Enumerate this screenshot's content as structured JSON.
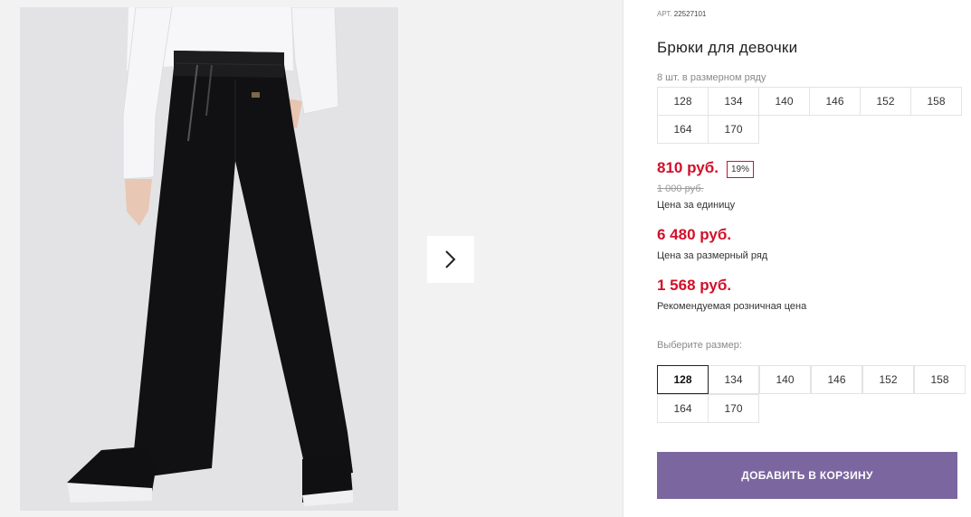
{
  "product": {
    "art_label": "АРТ.",
    "art_value": "22527101",
    "title": "Брюки для девочки",
    "pack_note": "8 шт. в размерном ряду"
  },
  "size_row": [
    "128",
    "134",
    "140",
    "146",
    "152",
    "158",
    "164",
    "170"
  ],
  "pricing": {
    "price": "810 руб.",
    "discount": "19%",
    "old_price": "1 000 руб.",
    "price_note": "Цена за единицу",
    "row_price": "6 480 руб.",
    "row_price_note": "Цена за размерный ряд",
    "retail_price": "1 568 руб.",
    "retail_price_note": "Рекомендуемая розничная цена"
  },
  "size_select": {
    "label": "Выберите размер:",
    "options": [
      "128",
      "134",
      "140",
      "146",
      "152",
      "158",
      "164",
      "170"
    ],
    "selected": "128"
  },
  "cart_button": "ДОБАВИТЬ В КОРЗИНУ",
  "colors": {
    "accent": "#d1102a",
    "button": "#7c66a0"
  },
  "icons": {
    "next": "chevron-right-icon"
  }
}
